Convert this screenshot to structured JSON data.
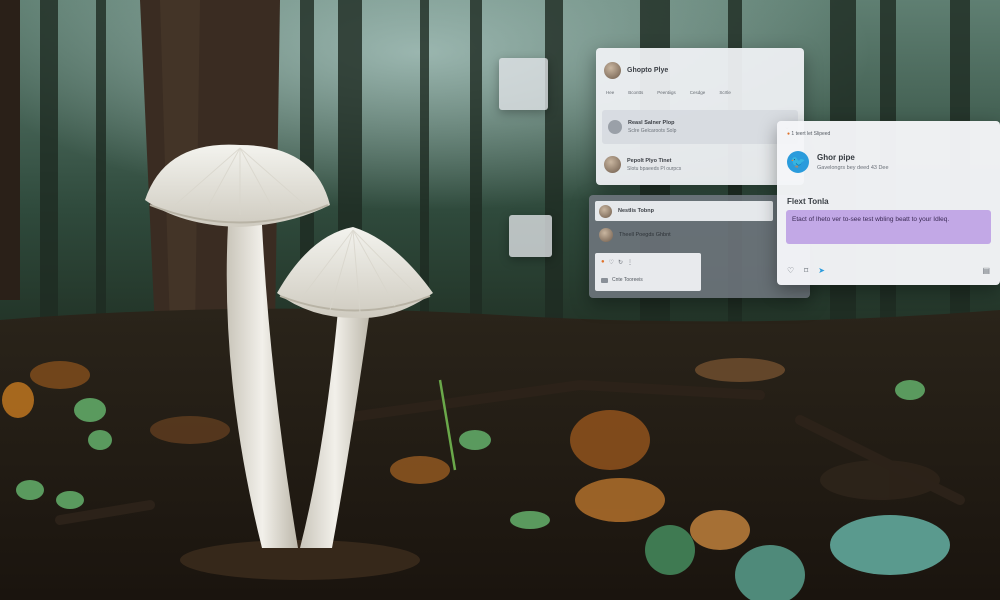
{
  "scene": {
    "description_tags": [
      "forest-floor",
      "two-white-mushrooms",
      "floating-ui-panels"
    ]
  },
  "panel_a": {
    "title": "Ghopto Plye",
    "tabs": [
      "Hee",
      "Bcontts",
      "Peentiigs",
      "Cesdge",
      "Scrtle"
    ],
    "row1_title": "Reasl Salner Plop",
    "row1_sub": "Sclre Gelcaroots Solp",
    "row2_title": "Pepolt Plyo Tinet",
    "row2_sub": "Slotu bpaeeds Pl ourpcs"
  },
  "panel_b": {
    "row1_text": "Nestlis Tobnp",
    "row2_text": "Theell Poegds Ghbnt",
    "row3_text": "Cnte Tooreeis"
  },
  "panel_c": {
    "top_line": "1 teert let Slipeed",
    "profile_name": "Ghor pipe",
    "profile_sub": "Gavelongrs bey deed 43 Dee",
    "section_title": "Flext Tonla",
    "highlight_text": "Etact of Iheto ver to-see test wbling beatt to your Idleq.",
    "icons": [
      "heart-icon",
      "bookmark-icon",
      "share-icon",
      "more-icon"
    ]
  }
}
